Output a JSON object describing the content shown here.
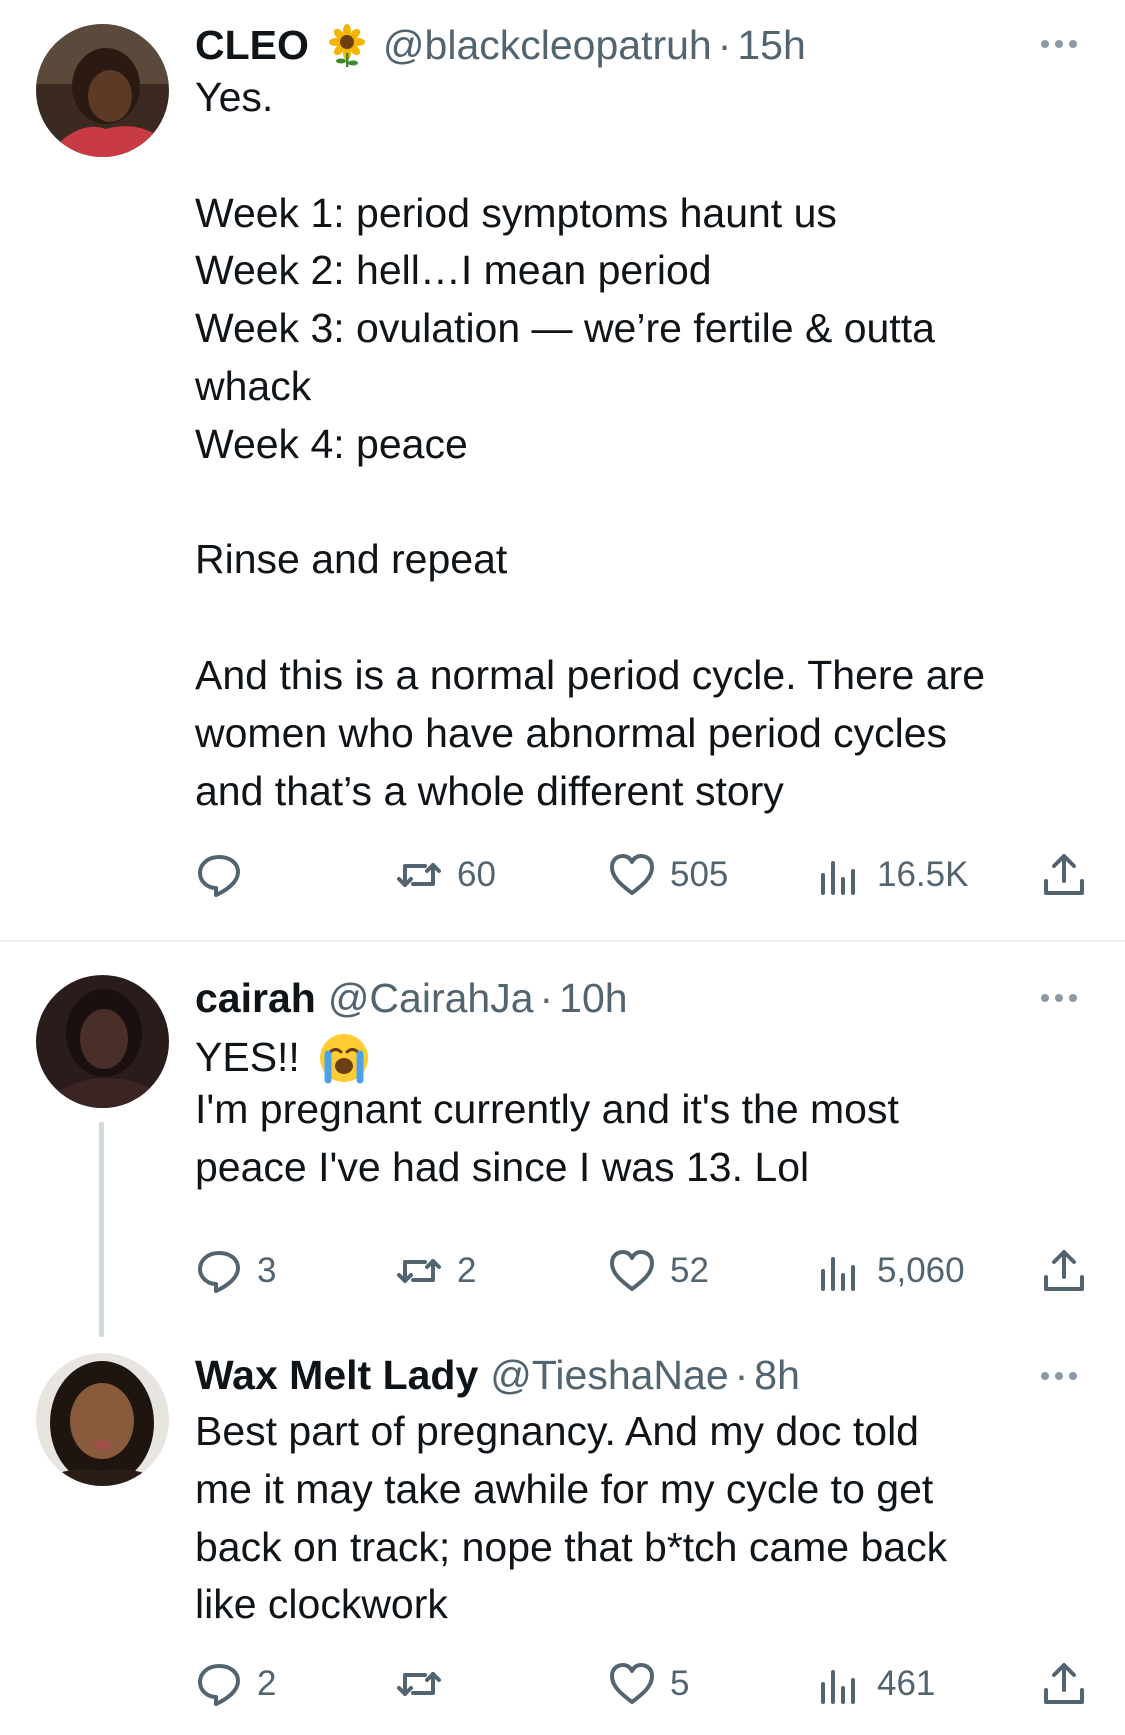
{
  "tweets": [
    {
      "name": "CLEO",
      "badge_icon": "sunflower-emoji",
      "handle": "@blackcleopatruh",
      "separator": "·",
      "time": "15h",
      "text": "Yes.\n\nWeek 1: period symptoms haunt us\nWeek 2: hell…I mean period\nWeek 3: ovulation — we’re fertile & outta\nwhack\nWeek 4: peace\n\nRinse and repeat\n\nAnd this is a normal period cycle. There are\nwomen who have abnormal period cycles\nand that’s a whole different story",
      "replies": "",
      "retweets": "60",
      "likes": "505",
      "views": "16.5K"
    },
    {
      "name": "cairah",
      "handle": "@CairahJa",
      "separator": "·",
      "time": "10h",
      "text_line1": "YES!!",
      "text_emoji": "loudly-crying-face-emoji",
      "text": "I'm pregnant currently and it's the most\npeace I've had since I was 13. Lol",
      "replies": "3",
      "retweets": "2",
      "likes": "52",
      "views": "5,060"
    },
    {
      "name": "Wax Melt Lady",
      "handle": "@TieshaNae",
      "separator": "·",
      "time": "8h",
      "text": "Best part of pregnancy. And my doc told\nme it may take awhile for my cycle to get\nback on track; nope that b*tch came back\nlike clockwork",
      "replies": "2",
      "retweets": "",
      "likes": "5",
      "views": "461"
    }
  ],
  "colors": {
    "text": "#0f1419",
    "secondary": "#536471",
    "divider": "#eff3f4",
    "thread_line": "#cfd9de"
  }
}
